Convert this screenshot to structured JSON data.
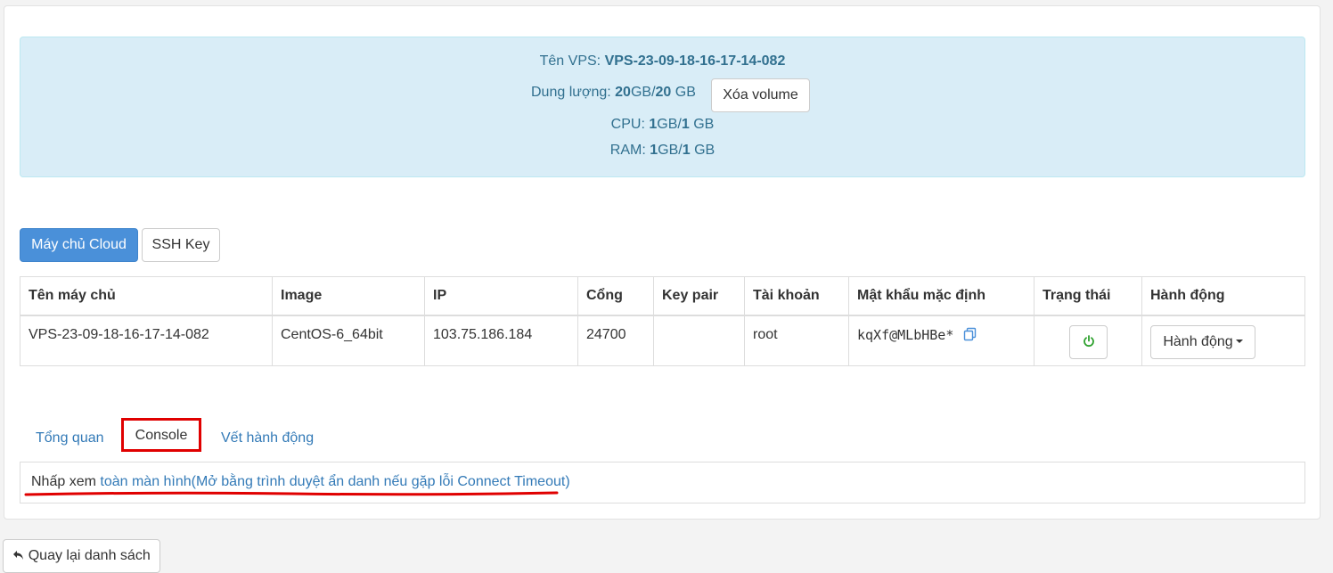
{
  "info": {
    "name_label": "Tên VPS:",
    "name_value": "VPS-23-09-18-16-17-14-082",
    "storage_label": "Dung lượng:",
    "storage_used": "20",
    "storage_sep": "GB/",
    "storage_total": "20",
    "storage_unit": "GB",
    "delete_volume_label": "Xóa volume",
    "cpu_label": "CPU:",
    "cpu_used": "1",
    "cpu_sep": "GB/",
    "cpu_total": "1",
    "cpu_unit": "GB",
    "ram_label": "RAM:",
    "ram_used": "1",
    "ram_sep": "GB/",
    "ram_total": "1",
    "ram_unit": "GB"
  },
  "subtabs": {
    "cloud_label": "Máy chủ Cloud",
    "ssh_label": "SSH Key"
  },
  "table": {
    "headers": [
      "Tên máy chủ",
      "Image",
      "IP",
      "Cổng",
      "Key pair",
      "Tài khoản",
      "Mật khẩu mặc định",
      "Trạng thái",
      "Hành động"
    ],
    "row": {
      "name": "VPS-23-09-18-16-17-14-082",
      "image": "CentOS-6_64bit",
      "ip": "103.75.186.184",
      "port": "24700",
      "key_pair": "",
      "account": "root",
      "password": "kqXf@MLbHBe*",
      "action_label": "Hành động"
    }
  },
  "tabs": {
    "overview": "Tổng quan",
    "console": "Console",
    "history": "Vết hành động"
  },
  "console": {
    "prefix": "Nhấp xem",
    "link": "toàn màn hình(Mở bằng trình duyệt ẩn danh nếu gặp lỗi Connect Timeout)"
  },
  "back_label": "Quay lại danh sách",
  "colors": {
    "primary": "#4a90d9",
    "info_bg": "#d9edf7",
    "power_green": "#2ca02c",
    "annotation_red": "#e00000"
  }
}
